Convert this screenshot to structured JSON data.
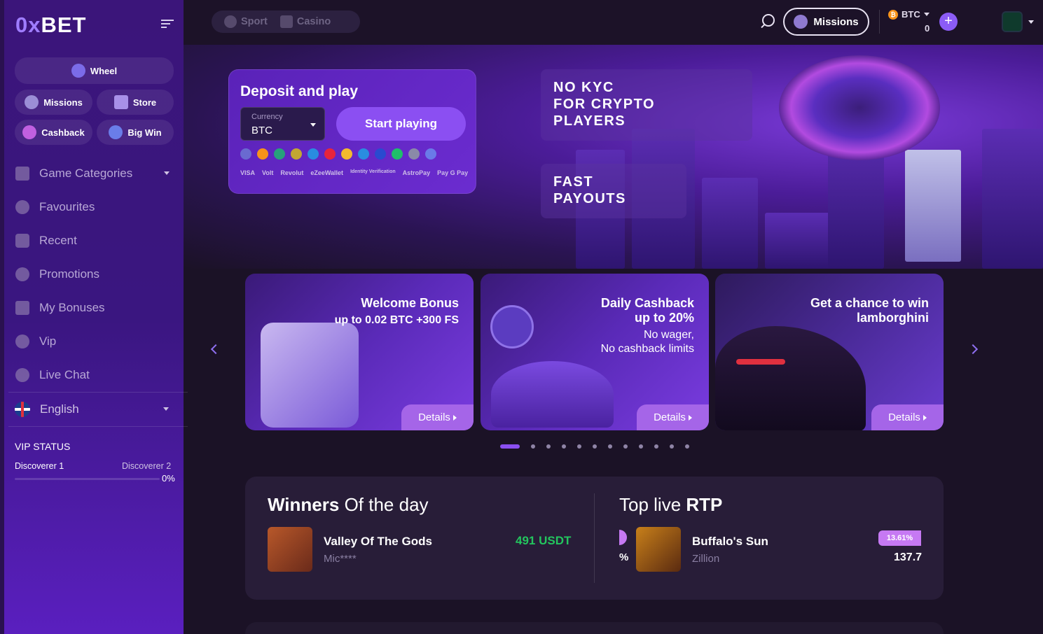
{
  "brand": {
    "logo_prefix": "0x",
    "logo_main": "BET",
    "accent": "#8b4ff2"
  },
  "sidebar": {
    "quick_buttons": [
      {
        "label": "Wheel",
        "icon": "wheel-icon"
      },
      {
        "label": "Missions",
        "icon": "missions-icon"
      },
      {
        "label": "Store",
        "icon": "store-icon"
      },
      {
        "label": "Cashback",
        "icon": "cashback-icon"
      },
      {
        "label": "Big Win",
        "icon": "big-win-icon"
      }
    ],
    "items": [
      {
        "label": "Game Categories",
        "icon": "categories-icon"
      },
      {
        "label": "Favourites",
        "icon": "heart-icon"
      },
      {
        "label": "Recent",
        "icon": "clock-icon"
      },
      {
        "label": "Promotions",
        "icon": "percent-icon"
      },
      {
        "label": "My Bonuses",
        "icon": "gift-icon"
      },
      {
        "label": "Vip",
        "icon": "diamond-icon"
      },
      {
        "label": "Live Chat",
        "icon": "chat-icon"
      }
    ],
    "language": "English",
    "vip": {
      "title": "VIP STATUS",
      "current": "Discoverer 1",
      "next": "Discoverer 2",
      "progress": "0%"
    }
  },
  "topbar": {
    "tabs": [
      "Sport",
      "Casino"
    ],
    "missions_label": "Missions",
    "currency": "BTC",
    "balance": "0",
    "plus": "+"
  },
  "hero": {
    "deposit": {
      "title": "Deposit and play",
      "currency_label": "Currency",
      "currency_value": "BTC",
      "start_label": "Start playing",
      "payments": [
        "VISA",
        "Volt",
        "Revolut",
        "eZeeWallet",
        "Identity Verification",
        "AstroPay",
        "Pay G Pay"
      ]
    },
    "tag1": [
      "NO KYC",
      "FOR CRYPTO",
      "PLAYERS"
    ],
    "tag2": [
      "FAST",
      "PAYOUTS"
    ]
  },
  "promos": [
    {
      "title": "Welcome Bonus",
      "sub": [
        "up to 0.02 BTC +300 FS"
      ],
      "details": "Details"
    },
    {
      "title": "Daily Cashback",
      "title2": "up to 20%",
      "sub": [
        "No wager,",
        "No cashback limits"
      ],
      "details": "Details"
    },
    {
      "title": "Get a chance to win",
      "title2": "lamborghini",
      "sub": [],
      "details": "Details"
    }
  ],
  "winners": {
    "title_bold": "Winners",
    "title_rest": "Of the day",
    "game": "Valley Of The Gods",
    "user": "Mic****",
    "amount": "491 USDT"
  },
  "rtp": {
    "title_rest": "Top live",
    "title_bold": "RTP",
    "game": "Buffalo's Sun",
    "provider": "Zillion",
    "badge": "13.61%",
    "value": "137.7",
    "partial": "%"
  }
}
